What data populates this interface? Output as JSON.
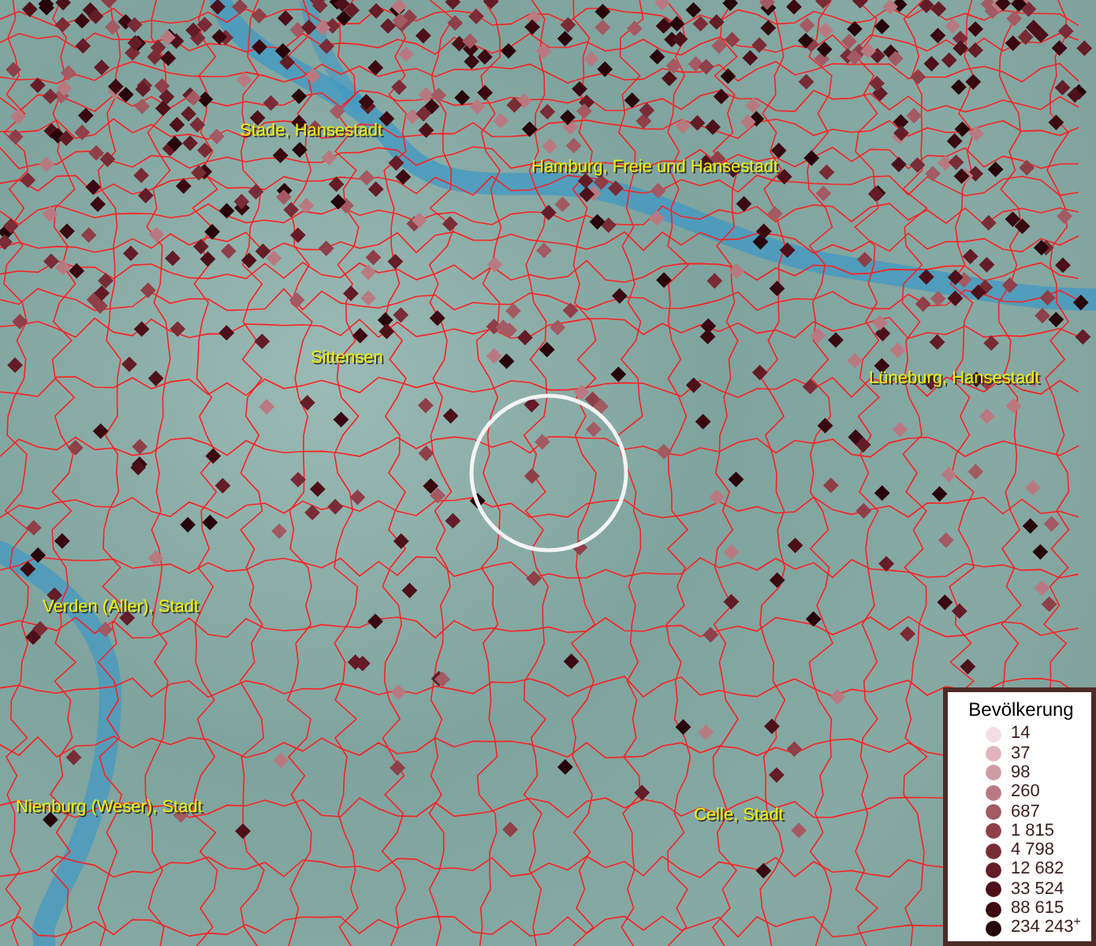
{
  "map": {
    "place_labels": [
      {
        "text": "Stade, Hansestadt"
      },
      {
        "text": "Hamburg, Freie und Hansestadt"
      },
      {
        "text": "Sittensen"
      },
      {
        "text": "Lüneburg, Hansestadt"
      },
      {
        "text": "Verden (Aller), Stadt"
      },
      {
        "text": "Nienburg (Weser), Stadt"
      },
      {
        "text": "Celle, Stadt"
      }
    ]
  },
  "legend": {
    "title": "Bevölkerung",
    "items": [
      {
        "label": "14",
        "color": "#f5dde6"
      },
      {
        "label": "37",
        "color": "#e0b5bf"
      },
      {
        "label": "98",
        "color": "#cf9ca2"
      },
      {
        "label": "260",
        "color": "#b87a80"
      },
      {
        "label": "687",
        "color": "#a35a62"
      },
      {
        "label": "1 815",
        "color": "#8f3f48"
      },
      {
        "label": "4 798",
        "color": "#7a2c36"
      },
      {
        "label": "12 682",
        "color": "#641c26"
      },
      {
        "label": "33 524",
        "color": "#4d1019"
      },
      {
        "label": "88 615",
        "color": "#3a0810"
      },
      {
        "label": "234 243$^{+}$",
        "color": "#26040a"
      }
    ]
  }
}
